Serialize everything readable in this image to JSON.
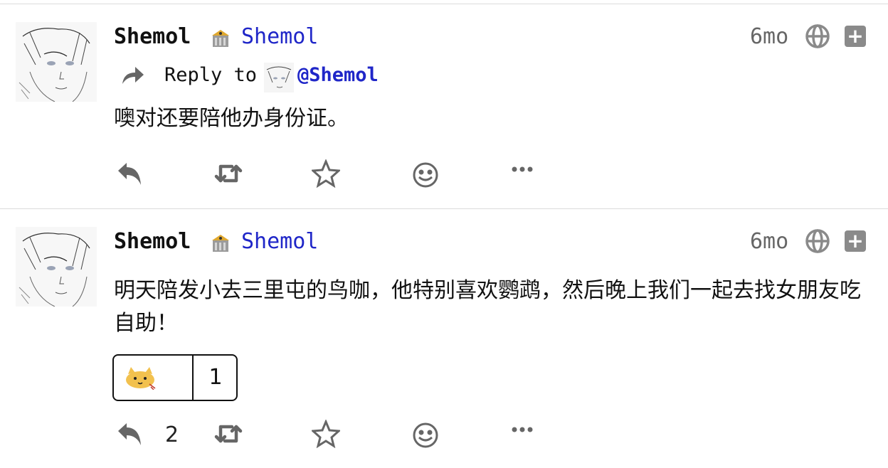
{
  "posts": [
    {
      "display_name": "Shemol",
      "instance_icon": "building-emoji-icon",
      "handle": "Shemol",
      "time": "6mo",
      "visibility_icon": "globe-icon",
      "reply": {
        "label": "Reply to",
        "handle": "@Shemol"
      },
      "content": "噢对还要陪他办身份证。",
      "actions": {
        "reply_count": "",
        "icons": [
          "reply-icon",
          "boost-icon",
          "star-icon",
          "emoji-icon",
          "more-icon"
        ]
      }
    },
    {
      "display_name": "Shemol",
      "instance_icon": "building-emoji-icon",
      "handle": "Shemol",
      "time": "6mo",
      "visibility_icon": "globe-icon",
      "content": "明天陪发小去三里屯的鸟咖，他特别喜欢鹦鹉，然后晚上我们一起去找女朋友吃自助！",
      "reaction": {
        "emoji": "cat-emoji-icon",
        "count": "1"
      },
      "actions": {
        "reply_count": "2",
        "icons": [
          "reply-icon",
          "boost-icon",
          "star-icon",
          "emoji-icon",
          "more-icon"
        ]
      }
    }
  ],
  "colors": {
    "link": "#1f26c8",
    "muted": "#666666",
    "divider": "#dcdcdc"
  }
}
